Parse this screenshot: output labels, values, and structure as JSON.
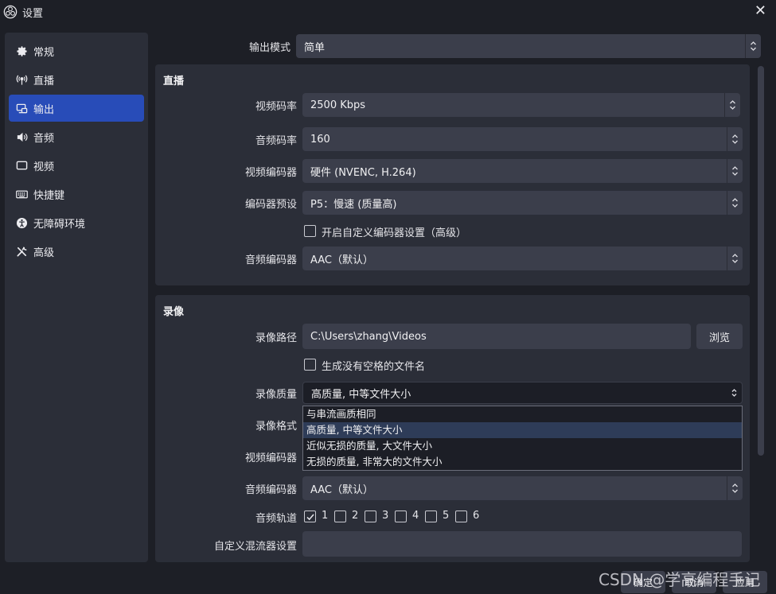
{
  "window": {
    "title": "设置",
    "close_glyph": "✕"
  },
  "sidebar": {
    "items": [
      {
        "label": "常规",
        "icon": "gear-icon",
        "active": false
      },
      {
        "label": "直播",
        "icon": "broadcast-icon",
        "active": false
      },
      {
        "label": "输出",
        "icon": "output-icon",
        "active": true
      },
      {
        "label": "音频",
        "icon": "speaker-icon",
        "active": false
      },
      {
        "label": "视频",
        "icon": "monitor-icon",
        "active": false
      },
      {
        "label": "快捷键",
        "icon": "keyboard-icon",
        "active": false
      },
      {
        "label": "无障碍环境",
        "icon": "accessibility-icon",
        "active": false
      },
      {
        "label": "高级",
        "icon": "tools-icon",
        "active": false
      }
    ]
  },
  "output_mode": {
    "label": "输出模式",
    "value": "简单"
  },
  "streaming": {
    "title": "直播",
    "video_bitrate": {
      "label": "视频码率",
      "value": "2500 Kbps"
    },
    "audio_bitrate": {
      "label": "音频码率",
      "value": "160"
    },
    "video_encoder": {
      "label": "视频编码器",
      "value": "硬件 (NVENC, H.264)"
    },
    "encoder_preset": {
      "label": "编码器预设",
      "value": "P5：慢速 (质量高)"
    },
    "custom_encoder": {
      "label": "开启自定义编码器设置（高级）",
      "checked": false
    },
    "audio_encoder": {
      "label": "音频编码器",
      "value": "AAC（默认）"
    }
  },
  "recording": {
    "title": "录像",
    "path": {
      "label": "录像路径",
      "value": "C:\\Users\\zhang\\Videos",
      "browse_label": "浏览"
    },
    "no_space": {
      "label": "生成没有空格的文件名",
      "checked": false
    },
    "quality": {
      "label": "录像质量",
      "value": "高质量, 中等文件大小",
      "options": [
        "与串流画质相同",
        "高质量, 中等文件大小",
        "近似无损的质量, 大文件大小",
        "无损的质量, 非常大的文件大小"
      ],
      "selected_index": 1
    },
    "format": {
      "label": "录像格式"
    },
    "video_encoder": {
      "label": "视频编码器"
    },
    "audio_encoder": {
      "label": "音频编码器",
      "value": "AAC（默认）"
    },
    "audio_tracks": {
      "label": "音频轨道",
      "tracks": [
        {
          "label": "1",
          "checked": true
        },
        {
          "label": "2",
          "checked": false
        },
        {
          "label": "3",
          "checked": false
        },
        {
          "label": "4",
          "checked": false
        },
        {
          "label": "5",
          "checked": false
        },
        {
          "label": "6",
          "checked": false
        }
      ]
    },
    "custom_muxer": {
      "label": "自定义混流器设置",
      "value": ""
    }
  },
  "buttons": {
    "ok": "确定",
    "cancel": "取消",
    "apply": "应用"
  },
  "watermark": "CSDN @学高编程手记",
  "colors": {
    "accent": "#284cb8",
    "panel": "#2b2e38",
    "background": "#1d1f26",
    "control": "#3b3e4b"
  }
}
